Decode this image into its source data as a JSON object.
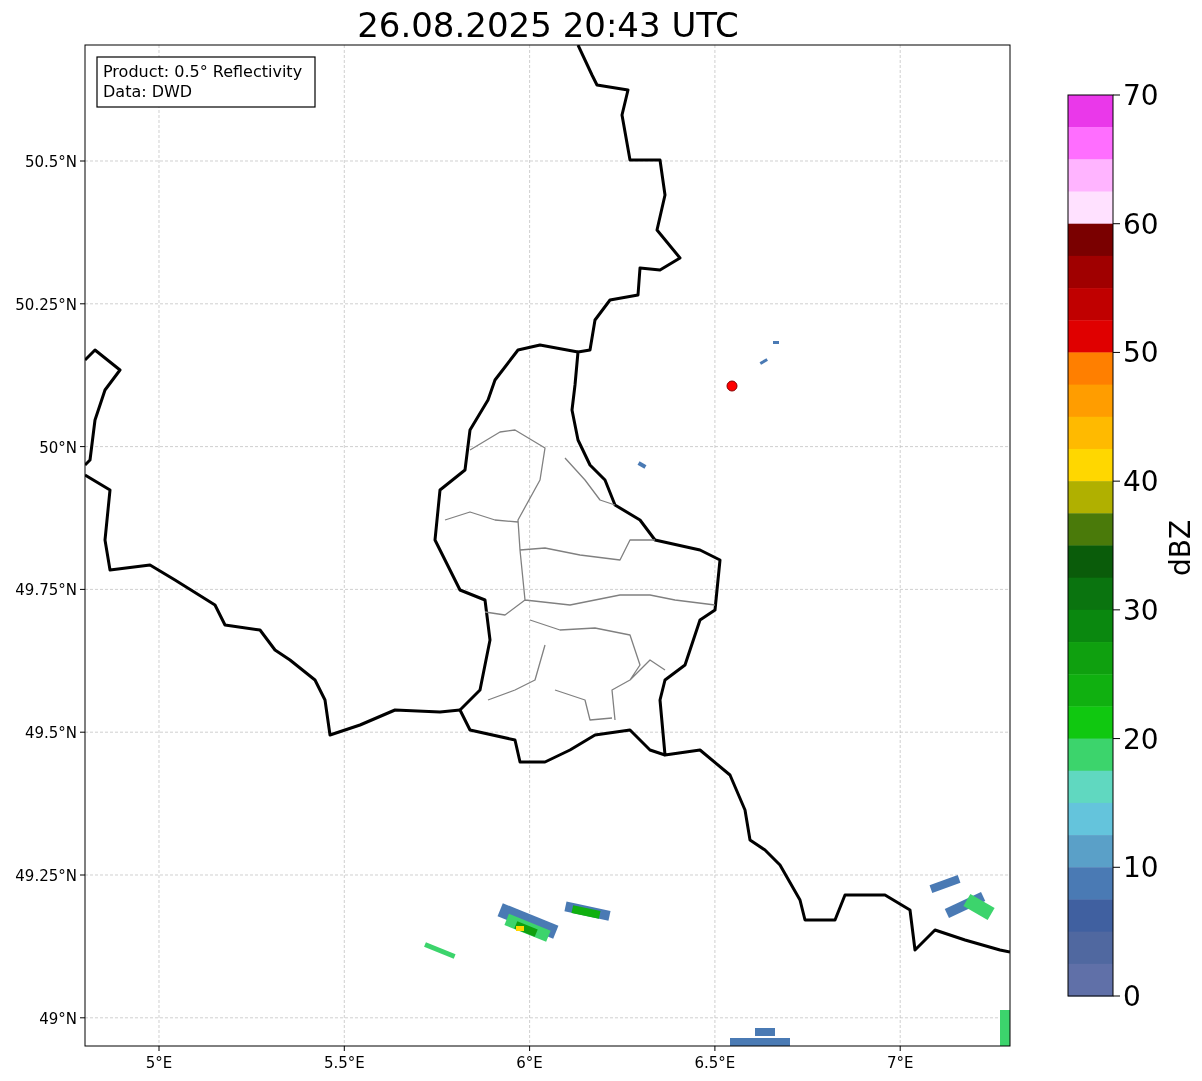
{
  "title": "26.08.2025 20:43 UTC",
  "info_box": [
    "Product: 0.5° Reflectivity",
    "Data: DWD"
  ],
  "y_ticks": [
    "50.5°N",
    "50.25°N",
    "50°N",
    "49.75°N",
    "49.5°N",
    "49.25°N",
    "49°N"
  ],
  "x_ticks": [
    "5°E",
    "5.5°E",
    "6°E",
    "6.5°E",
    "7°E"
  ],
  "colorbar": {
    "label": "dBZ",
    "ticks": [
      "70",
      "60",
      "50",
      "40",
      "30",
      "20",
      "10",
      "0"
    ],
    "bins": [
      {
        "color": "#ea38ea"
      },
      {
        "color": "#ff6eff"
      },
      {
        "color": "#ffb4ff"
      },
      {
        "color": "#ffe1ff"
      },
      {
        "color": "#7a0000"
      },
      {
        "color": "#a00000"
      },
      {
        "color": "#c00000"
      },
      {
        "color": "#e00000"
      },
      {
        "color": "#ff7f00"
      },
      {
        "color": "#ff9d00"
      },
      {
        "color": "#ffba00"
      },
      {
        "color": "#ffd700"
      },
      {
        "color": "#b0b000"
      },
      {
        "color": "#4a7a0a"
      },
      {
        "color": "#0a5c0a"
      },
      {
        "color": "#0a740f"
      },
      {
        "color": "#0a880f"
      },
      {
        "color": "#0fa00f"
      },
      {
        "color": "#10b010"
      },
      {
        "color": "#10c810"
      },
      {
        "color": "#3cd46c"
      },
      {
        "color": "#60d8c0"
      },
      {
        "color": "#64c4dc"
      },
      {
        "color": "#5aa0c8"
      },
      {
        "color": "#4a7ab4"
      },
      {
        "color": "#4060a0"
      },
      {
        "color": "#5068a0"
      },
      {
        "color": "#6070a8"
      }
    ]
  }
}
